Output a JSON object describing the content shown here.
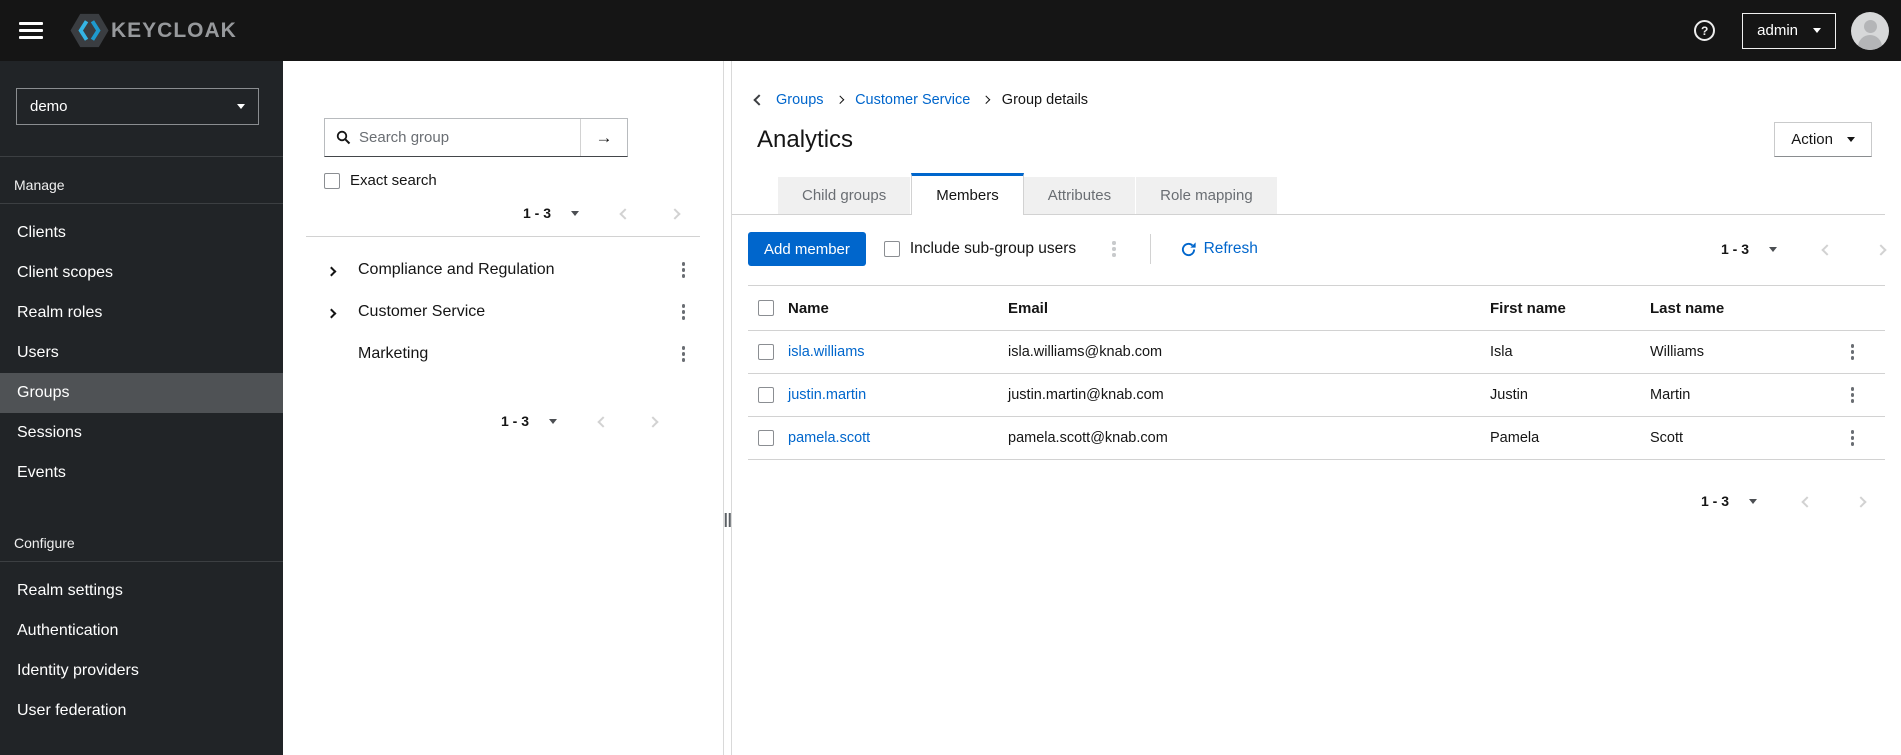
{
  "topbar": {
    "brand_text": "KEYCLOAK",
    "username": "admin",
    "help_glyph": "?"
  },
  "sidebar": {
    "realm": "demo",
    "selected": "Groups",
    "sections": [
      {
        "label": "Manage",
        "items": [
          {
            "label": "Clients"
          },
          {
            "label": "Client scopes"
          },
          {
            "label": "Realm roles"
          },
          {
            "label": "Users"
          },
          {
            "label": "Groups"
          },
          {
            "label": "Sessions"
          },
          {
            "label": "Events"
          }
        ]
      },
      {
        "label": "Configure",
        "items": [
          {
            "label": "Realm settings"
          },
          {
            "label": "Authentication"
          },
          {
            "label": "Identity providers"
          },
          {
            "label": "User federation"
          }
        ]
      }
    ]
  },
  "tree_panel": {
    "search": {
      "placeholder": "Search group"
    },
    "exact_search_label": "Exact search",
    "pagination_top": {
      "range": "1 - 3"
    },
    "pagination_bottom": {
      "range": "1 - 3"
    },
    "groups": [
      {
        "label": "Compliance and Regulation",
        "expandable": true
      },
      {
        "label": "Customer Service",
        "expandable": true
      },
      {
        "label": "Marketing",
        "expandable": false
      }
    ]
  },
  "main": {
    "breadcrumb": {
      "items": [
        {
          "label": "Groups",
          "link": true
        },
        {
          "label": "Customer Service",
          "link": true
        },
        {
          "label": "Group details",
          "link": false
        }
      ]
    },
    "title": "Analytics",
    "action_label": "Action",
    "active_tab": "Members",
    "tabs": [
      {
        "label": "Child groups"
      },
      {
        "label": "Members"
      },
      {
        "label": "Attributes"
      },
      {
        "label": "Role mapping"
      }
    ],
    "toolbar": {
      "add_member_label": "Add member",
      "include_subgroups_label": "Include sub-group users",
      "refresh_label": "Refresh",
      "pagination": {
        "range": "1 - 3"
      }
    },
    "table": {
      "columns": [
        "Name",
        "Email",
        "First name",
        "Last name"
      ],
      "rows": [
        {
          "name": "isla.williams",
          "email": "isla.williams@knab.com",
          "first_name": "Isla",
          "last_name": "Williams"
        },
        {
          "name": "justin.martin",
          "email": "justin.martin@knab.com",
          "first_name": "Justin",
          "last_name": "Martin"
        },
        {
          "name": "pamela.scott",
          "email": "pamela.scott@knab.com",
          "first_name": "Pamela",
          "last_name": "Scott"
        }
      ]
    },
    "pagination_bottom": {
      "range": "1 - 3"
    }
  },
  "icons": {
    "menu-icon": "hamburger bars",
    "help-icon": "?",
    "chevron-down-icon": "▾",
    "search-icon": "magnifier",
    "arrow-right-icon": "→",
    "kebab-icon": "⋮",
    "chevron-right-icon": "›",
    "chevron-left-icon": "‹",
    "refresh-icon": "⟳",
    "back-icon": "‹",
    "avatar-icon": "person silhouette"
  },
  "colors": {
    "accent": "#0066cc",
    "topbar_bg": "#151515",
    "sidebar_bg": "#212427",
    "sidebar_selected_bg": "#4f5255",
    "border": "#d2d2d2",
    "muted_text": "#6a6e73",
    "logo_blue": "#35b5e5",
    "logo_gray": "#97999c"
  }
}
